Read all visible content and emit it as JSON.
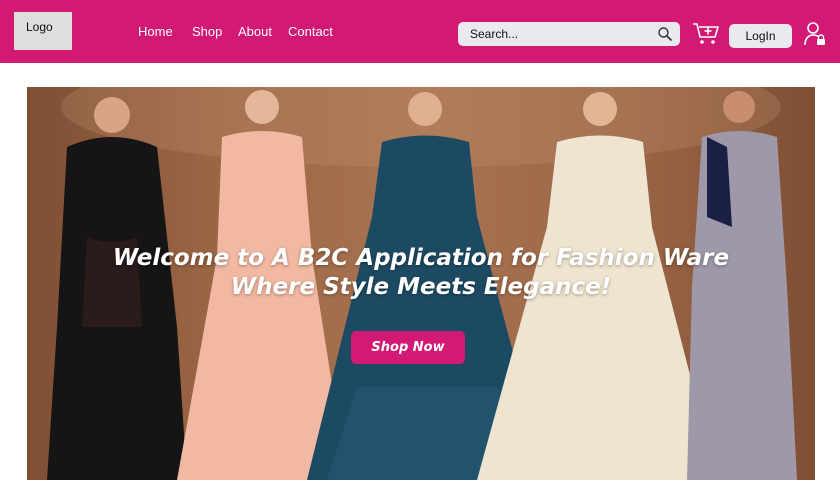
{
  "header": {
    "logo_label": "Logo",
    "nav": [
      "Home",
      "Shop",
      "About",
      "Contact"
    ],
    "search_placeholder": "Search...",
    "login_label": "LogIn",
    "icons": {
      "search": "search-icon",
      "cart": "cart-add-icon",
      "user": "user-lock-icon"
    },
    "brand_color": "#d21a75"
  },
  "hero": {
    "title_line1": "Welcome to A B2C Application for Fashion Ware",
    "title_line2": "Where Style Meets Elegance!",
    "cta_label": "Shop Now"
  }
}
